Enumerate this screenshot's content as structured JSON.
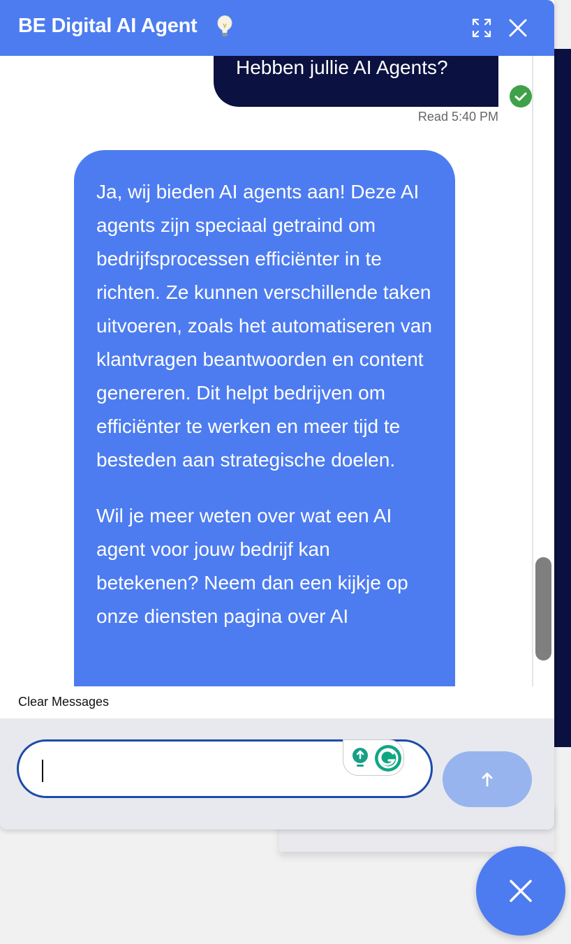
{
  "header": {
    "title": "BE Digital AI Agent",
    "icons": {
      "title_emoji": "lightbulb-icon",
      "expand": "expand-icon",
      "close": "close-icon"
    }
  },
  "messages": [
    {
      "role": "user",
      "text": "Hebben jullie AI Agents?",
      "status": "Read 5:40 PM"
    },
    {
      "role": "assistant",
      "paragraphs": [
        "Ja, wij bieden AI agents aan! Deze AI agents zijn speciaal getraind om bedrijfsprocessen efficiënter in te richten. Ze kunnen verschillende taken uitvoeren, zoals het automatiseren van klantvragen beantwoorden en content genereren. Dit helpt bedrijven om efficiënter te werken en meer tijd te besteden aan strategische doelen.",
        "Wil je meer weten over wat een AI agent voor jouw bedrijf kan betekenen? Neem dan een kijkje op onze diensten pagina over AI"
      ]
    }
  ],
  "clear_label": "Clear Messages",
  "composer": {
    "value": "",
    "placeholder": ""
  },
  "colors": {
    "brand": "#4d7cf0",
    "user_bubble": "#0b1140",
    "send_disabled": "#97b4ee",
    "read_check": "#3fa14a"
  }
}
